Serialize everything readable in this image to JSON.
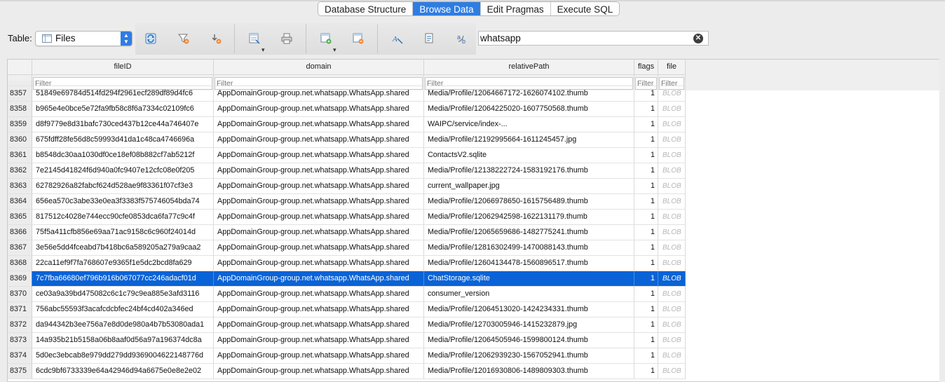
{
  "tabs": [
    {
      "label": "Database Structure",
      "active": false
    },
    {
      "label": "Browse Data",
      "active": true
    },
    {
      "label": "Edit Pragmas",
      "active": false
    },
    {
      "label": "Execute SQL",
      "active": false
    }
  ],
  "table_selector": {
    "label": "Table:",
    "value": "Files"
  },
  "toolbar_icons": [
    "refresh-icon",
    "clear-filters-icon",
    "clear-sort-icon",
    "save-table-icon",
    "print-icon",
    "insert-record-icon",
    "delete-record-icon",
    "find-icon",
    "find-replace-icon",
    "copy-icon"
  ],
  "search": {
    "value": "whatsapp"
  },
  "columns": [
    "fileID",
    "domain",
    "relativePath",
    "flags",
    "file"
  ],
  "filter_placeholder": "Filter",
  "colors": {
    "selection": "#0a63d6",
    "accent": "#2f7de1",
    "blob_text": "#b6b6b6"
  },
  "rows": [
    {
      "n": "8357",
      "fileID": "51849e69784d514fd294f2961ecf289df89d4fc6",
      "domain": "AppDomainGroup-group.net.whatsapp.WhatsApp.shared",
      "relativePath": "Media/Profile/12064667172-1626074102.thumb",
      "flags": "1",
      "file": "BLOB"
    },
    {
      "n": "8358",
      "fileID": "b965e4e0bce5e72fa9fb58c8f6a7334c02109fc6",
      "domain": "AppDomainGroup-group.net.whatsapp.WhatsApp.shared",
      "relativePath": "Media/Profile/12064225020-1607750568.thumb",
      "flags": "1",
      "file": "BLOB"
    },
    {
      "n": "8359",
      "fileID": "d8f9779e8d31bafc730ced437b12ce44a746407e",
      "domain": "AppDomainGroup-group.net.whatsapp.WhatsApp.shared",
      "relativePath": "WAIPC/service/index-...",
      "flags": "1",
      "file": "BLOB"
    },
    {
      "n": "8360",
      "fileID": "675fdff28fe56d8c59993d41da1c48ca4746696a",
      "domain": "AppDomainGroup-group.net.whatsapp.WhatsApp.shared",
      "relativePath": "Media/Profile/12192995664-1611245457.jpg",
      "flags": "1",
      "file": "BLOB"
    },
    {
      "n": "8361",
      "fileID": "b8548dc30aa1030df0ce18ef08b882cf7ab5212f",
      "domain": "AppDomainGroup-group.net.whatsapp.WhatsApp.shared",
      "relativePath": "ContactsV2.sqlite",
      "flags": "1",
      "file": "BLOB"
    },
    {
      "n": "8362",
      "fileID": "7e2145d41824f6d940a0fc9407e12cfc08e0f205",
      "domain": "AppDomainGroup-group.net.whatsapp.WhatsApp.shared",
      "relativePath": "Media/Profile/12138222724-1583192176.thumb",
      "flags": "1",
      "file": "BLOB"
    },
    {
      "n": "8363",
      "fileID": "62782926a82fabcf624d528ae9f83361f07cf3e3",
      "domain": "AppDomainGroup-group.net.whatsapp.WhatsApp.shared",
      "relativePath": "current_wallpaper.jpg",
      "flags": "1",
      "file": "BLOB"
    },
    {
      "n": "8364",
      "fileID": "656ea570c3abe33e0ea3f3383f575746054bda74",
      "domain": "AppDomainGroup-group.net.whatsapp.WhatsApp.shared",
      "relativePath": "Media/Profile/12066978650-1615756489.thumb",
      "flags": "1",
      "file": "BLOB"
    },
    {
      "n": "8365",
      "fileID": "817512c4028e744ecc90cfe0853dca6fa77c9c4f",
      "domain": "AppDomainGroup-group.net.whatsapp.WhatsApp.shared",
      "relativePath": "Media/Profile/12062942598-1622131179.thumb",
      "flags": "1",
      "file": "BLOB"
    },
    {
      "n": "8366",
      "fileID": "75f5a411cfb856e69aa71ac9158c6c960f24014d",
      "domain": "AppDomainGroup-group.net.whatsapp.WhatsApp.shared",
      "relativePath": "Media/Profile/12065659686-1482775241.thumb",
      "flags": "1",
      "file": "BLOB"
    },
    {
      "n": "8367",
      "fileID": "3e56e5dd4fceabd7b418bc6a589205a279a9caa2",
      "domain": "AppDomainGroup-group.net.whatsapp.WhatsApp.shared",
      "relativePath": "Media/Profile/12816302499-1470088143.thumb",
      "flags": "1",
      "file": "BLOB"
    },
    {
      "n": "8368",
      "fileID": "22ca11ef9f7fa768607e9365f1e5dc2bcd8fa629",
      "domain": "AppDomainGroup-group.net.whatsapp.WhatsApp.shared",
      "relativePath": "Media/Profile/12604134478-1560896517.thumb",
      "flags": "1",
      "file": "BLOB"
    },
    {
      "n": "8369",
      "fileID": "7c7fba66680ef796b916b067077cc246adacf01d",
      "domain": "AppDomainGroup-group.net.whatsapp.WhatsApp.shared",
      "relativePath": "ChatStorage.sqlite",
      "flags": "1",
      "file": "BLOB",
      "selected": true
    },
    {
      "n": "8370",
      "fileID": "ce03a9a39bd475082c6c1c79c9ea885e3afd3116",
      "domain": "AppDomainGroup-group.net.whatsapp.WhatsApp.shared",
      "relativePath": "consumer_version",
      "flags": "1",
      "file": "BLOB"
    },
    {
      "n": "8371",
      "fileID": "756abc55593f3acafcdcbfec24bf4cd402a346ed",
      "domain": "AppDomainGroup-group.net.whatsapp.WhatsApp.shared",
      "relativePath": "Media/Profile/12064513020-1424234331.thumb",
      "flags": "1",
      "file": "BLOB"
    },
    {
      "n": "8372",
      "fileID": "da944342b3ee756a7e8d0de980a4b7b53080ada1",
      "domain": "AppDomainGroup-group.net.whatsapp.WhatsApp.shared",
      "relativePath": "Media/Profile/12703005946-1415232879.jpg",
      "flags": "1",
      "file": "BLOB"
    },
    {
      "n": "8373",
      "fileID": "14a935b21b5158a06b8aaf0d56a97a196374dc8a",
      "domain": "AppDomainGroup-group.net.whatsapp.WhatsApp.shared",
      "relativePath": "Media/Profile/12064505946-1599800124.thumb",
      "flags": "1",
      "file": "BLOB"
    },
    {
      "n": "8374",
      "fileID": "5d0ec3ebcab8e979dd279dd9369004622148776d",
      "domain": "AppDomainGroup-group.net.whatsapp.WhatsApp.shared",
      "relativePath": "Media/Profile/12062939230-1567052941.thumb",
      "flags": "1",
      "file": "BLOB"
    },
    {
      "n": "8375",
      "fileID": "6cdc9bf6733339e64a42946d94a6675e0e8e2e02",
      "domain": "AppDomainGroup-group.net.whatsapp.WhatsApp.shared",
      "relativePath": "Media/Profile/12016930806-1489809303.thumb",
      "flags": "1",
      "file": "BLOB"
    }
  ]
}
